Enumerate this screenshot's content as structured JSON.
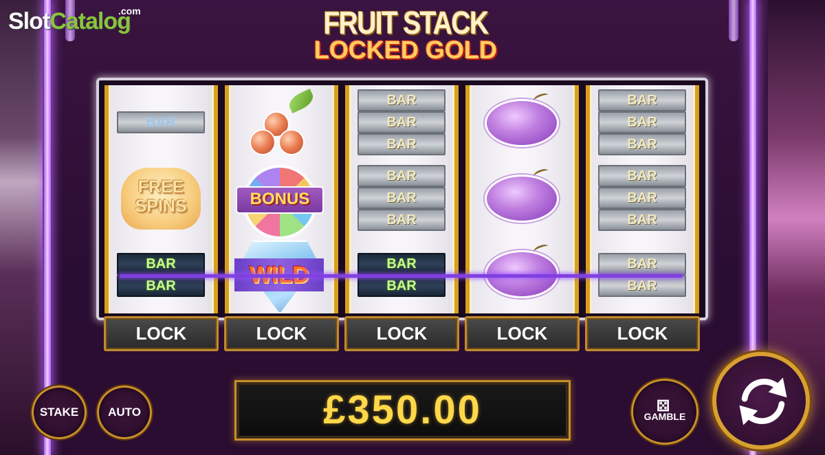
{
  "watermark": {
    "brand_part1": "Slot",
    "brand_part2": "Catalog",
    "brand_suffix": ".com"
  },
  "game": {
    "title_line1": "FRUIT STACK",
    "title_line2": "LOCKED GOLD"
  },
  "reels": [
    {
      "symbols": [
        "BAR",
        "FREE SPINS",
        "BAR",
        "BAR"
      ]
    },
    {
      "symbols": [
        "cherries",
        "BONUS",
        "WILD"
      ]
    },
    {
      "symbols": [
        "BAR",
        "BAR",
        "BAR",
        "BAR",
        "BAR",
        "BAR",
        "BAR",
        "BAR"
      ]
    },
    {
      "symbols": [
        "plum",
        "plum",
        "plum"
      ]
    },
    {
      "symbols": [
        "BAR",
        "BAR",
        "BAR",
        "BAR",
        "BAR",
        "BAR",
        "BAR",
        "BAR"
      ]
    }
  ],
  "bar_label": "BAR",
  "free_spins_label": "FREE\nSPINS",
  "bonus_label": "BONUS",
  "wild_label": "WILD",
  "lock_buttons": [
    "LOCK",
    "LOCK",
    "LOCK",
    "LOCK",
    "LOCK"
  ],
  "controls": {
    "stake_label": "STAKE",
    "auto_label": "AUTO",
    "gamble_label": "GAMBLE",
    "spin_icon": "refresh-arrows-icon",
    "dice_icon": "dice-icon"
  },
  "balance": "£350.00",
  "colors": {
    "gold": "#c8902a",
    "balance_text": "#ffd84a",
    "win_line": "#8040e0",
    "neon": "#b060ff"
  }
}
